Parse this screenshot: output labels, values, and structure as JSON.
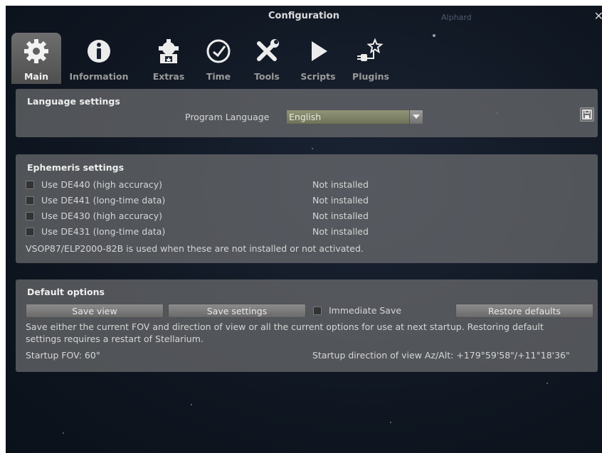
{
  "window": {
    "title": "Configuration",
    "close_glyph": "✕"
  },
  "sky_label": "Alphard",
  "tabs": [
    {
      "label": "Main",
      "icon": "gear-icon",
      "active": true
    },
    {
      "label": "Information",
      "icon": "info-icon"
    },
    {
      "label": "Extras",
      "icon": "extras-icon"
    },
    {
      "label": "Time",
      "icon": "clock-icon"
    },
    {
      "label": "Tools",
      "icon": "tools-icon"
    },
    {
      "label": "Scripts",
      "icon": "play-icon"
    },
    {
      "label": "Plugins",
      "icon": "plugin-icon"
    }
  ],
  "language": {
    "title": "Language settings",
    "program_language_label": "Program Language",
    "program_language_value": "English",
    "save_icon": "floppy-icon"
  },
  "ephemeris": {
    "title": "Ephemeris settings",
    "items": [
      {
        "label": "Use DE440 (high accuracy)",
        "status": "Not installed",
        "checked": false
      },
      {
        "label": "Use DE441 (long-time data)",
        "status": "Not installed",
        "checked": false
      },
      {
        "label": "Use DE430 (high accuracy)",
        "status": "Not installed",
        "checked": false
      },
      {
        "label": "Use DE431 (long-time data)",
        "status": "Not installed",
        "checked": false
      }
    ],
    "note": "VSOP87/ELP2000-82B is used when these are not installed or not activated."
  },
  "defaults": {
    "title": "Default options",
    "save_view": "Save view",
    "save_settings": "Save settings",
    "immediate_save": "Immediate Save",
    "immediate_save_checked": false,
    "restore_defaults": "Restore defaults",
    "description_line1": "Save either the current FOV and direction of view or all the current options for use at next startup. Restoring default",
    "description_line2": "settings requires a restart of Stellarium.",
    "startup_fov": "Startup FOV: 60°",
    "startup_direction": "Startup direction of view Az/Alt: +179°59'58\"/+11°18'36\""
  },
  "colors": {
    "accent_select": "#7f8366",
    "panel": "#7a7a7a"
  }
}
